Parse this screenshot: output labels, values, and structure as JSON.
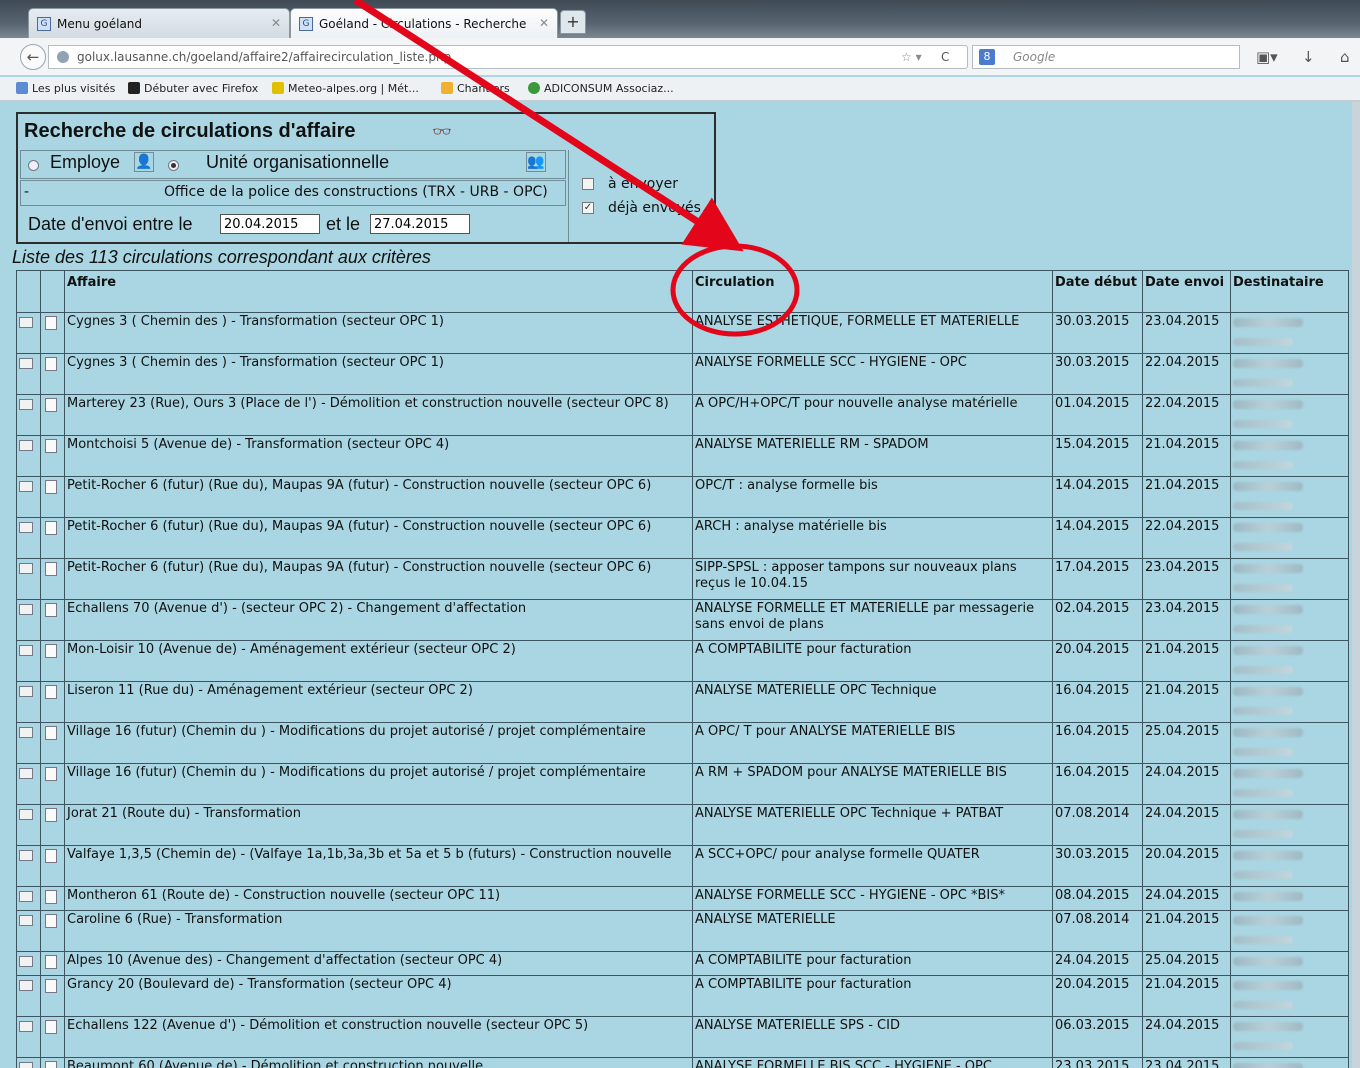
{
  "browser": {
    "tabs": [
      {
        "label": "Menu goéland"
      },
      {
        "label": "Goéland - Circulations - Recherche"
      }
    ],
    "url": "golux.lausanne.ch/goeland/affaire2/affairecirculation_liste.php",
    "search_placeholder": "Google",
    "bookmarks": [
      "Les plus visités",
      "Débuter avec Firefox",
      "Meteo-alpes.org | Mét...",
      "Chantiers",
      "ADICONSUM Associaz..."
    ]
  },
  "criteria": {
    "title": "Recherche de circulations d'affaire",
    "employe_label": "Employe",
    "unite_label": "Unité organisationnelle",
    "empty_value": "-",
    "unite_value": "Office de la police des constructions (TRX - URB - OPC)",
    "a_envoyer": "à envoyer",
    "deja_envoyes": "déjà envoyés",
    "date_label": "Date d'envoi entre le",
    "date_from": "20.04.2015",
    "date_sep": "et le",
    "date_to": "27.04.2015"
  },
  "list_title": "Liste des 113 circulations correspondant aux critères",
  "table": {
    "headers": {
      "affaire": "Affaire",
      "circulation": "Circulation",
      "date_debut": "Date début",
      "date_envoi": "Date envoi",
      "destinataire": "Destinataire"
    },
    "rows": [
      {
        "affaire": "Cygnes 3 ( Chemin des ) - Transformation (secteur OPC 1)",
        "circulation": "ANALYSE ESTHETIQUE, FORMELLE ET MATERIELLE",
        "debut": "30.03.2015",
        "envoi": "23.04.2015"
      },
      {
        "affaire": "Cygnes 3 ( Chemin des ) - Transformation (secteur OPC 1)",
        "circulation": "ANALYSE FORMELLE SCC - HYGIENE - OPC",
        "debut": "30.03.2015",
        "envoi": "22.04.2015"
      },
      {
        "affaire": "Marterey 23 (Rue), Ours 3 (Place de l') - Démolition et construction nouvelle (secteur OPC 8)",
        "circulation": "A OPC/H+OPC/T pour nouvelle analyse matérielle",
        "debut": "01.04.2015",
        "envoi": "22.04.2015"
      },
      {
        "affaire": "Montchoisi 5 (Avenue de) - Transformation (secteur OPC 4)",
        "circulation": "ANALYSE MATERIELLE RM - SPADOM",
        "debut": "15.04.2015",
        "envoi": "21.04.2015"
      },
      {
        "affaire": "Petit-Rocher 6 (futur) (Rue du), Maupas 9A (futur) - Construction nouvelle (secteur OPC 6)",
        "circulation": "OPC/T : analyse formelle bis",
        "debut": "14.04.2015",
        "envoi": "21.04.2015"
      },
      {
        "affaire": "Petit-Rocher 6 (futur) (Rue du), Maupas 9A (futur) - Construction nouvelle (secteur OPC 6)",
        "circulation": "ARCH : analyse matérielle bis",
        "debut": "14.04.2015",
        "envoi": "22.04.2015"
      },
      {
        "affaire": "Petit-Rocher 6 (futur) (Rue du), Maupas 9A (futur) - Construction nouvelle (secteur OPC 6)",
        "circulation": "SIPP-SPSL : apposer tampons sur nouveaux plans reçus le 10.04.15",
        "debut": "17.04.2015",
        "envoi": "23.04.2015"
      },
      {
        "affaire": "Echallens 70 (Avenue d') - (secteur OPC 2) - Changement d'affectation",
        "circulation": "ANALYSE FORMELLE ET MATERIELLE par messagerie sans envoi de plans",
        "debut": "02.04.2015",
        "envoi": "23.04.2015"
      },
      {
        "affaire": "Mon-Loisir 10 (Avenue de) - Aménagement extérieur (secteur OPC 2)",
        "circulation": "A COMPTABILITE pour facturation",
        "debut": "20.04.2015",
        "envoi": "21.04.2015"
      },
      {
        "affaire": "Liseron 11 (Rue du) - Aménagement extérieur (secteur OPC 2)",
        "circulation": "ANALYSE MATERIELLE OPC Technique",
        "debut": "16.04.2015",
        "envoi": "21.04.2015"
      },
      {
        "affaire": "Village 16 (futur) (Chemin du ) - Modifications du projet autorisé / projet complémentaire",
        "circulation": "A OPC/ T pour ANALYSE MATERIELLE BIS",
        "debut": "16.04.2015",
        "envoi": "25.04.2015"
      },
      {
        "affaire": "Village 16 (futur) (Chemin du ) - Modifications du projet autorisé / projet complémentaire",
        "circulation": "A RM + SPADOM pour ANALYSE MATERIELLE BIS",
        "debut": "16.04.2015",
        "envoi": "24.04.2015"
      },
      {
        "affaire": "Jorat 21 (Route du) - Transformation",
        "circulation": "ANALYSE MATERIELLE OPC Technique + PATBAT",
        "debut": "07.08.2014",
        "envoi": "24.04.2015"
      },
      {
        "affaire": "Valfaye 1,3,5 (Chemin de) - (Valfaye 1a,1b,3a,3b et 5a et 5 b (futurs) - Construction nouvelle",
        "circulation": "A SCC+OPC/ pour analyse formelle QUATER",
        "debut": "30.03.2015",
        "envoi": "20.04.2015"
      },
      {
        "affaire": "Montheron 61 (Route de) - Construction nouvelle (secteur OPC 11)",
        "circulation": "ANALYSE FORMELLE SCC - HYGIENE - OPC *BIS*",
        "debut": "08.04.2015",
        "envoi": "24.04.2015",
        "short": true
      },
      {
        "affaire": "Caroline 6 (Rue) - Transformation",
        "circulation": "ANALYSE MATERIELLE",
        "debut": "07.08.2014",
        "envoi": "21.04.2015"
      },
      {
        "affaire": "Alpes 10 (Avenue des) - Changement d'affectation (secteur OPC 4)",
        "circulation": "A COMPTABILITE pour facturation",
        "debut": "24.04.2015",
        "envoi": "25.04.2015",
        "short": true
      },
      {
        "affaire": "Grancy 20 (Boulevard de) - Transformation (secteur OPC 4)",
        "circulation": "A COMPTABILITE pour facturation",
        "debut": "20.04.2015",
        "envoi": "21.04.2015"
      },
      {
        "affaire": "Echallens 122 (Avenue d') - Démolition et construction nouvelle (secteur OPC 5)",
        "circulation": "ANALYSE MATERIELLE SPS - CID",
        "debut": "06.03.2015",
        "envoi": "24.04.2015"
      },
      {
        "affaire": "Beaumont 60 (Avenue de) - Démolition et construction nouvelle",
        "circulation": "ANALYSE FORMELLE BIS SCC - HYGIENE - OPC",
        "debut": "23.03.2015",
        "envoi": "23.04.2015"
      }
    ]
  },
  "annotation_color": "#e3061b"
}
